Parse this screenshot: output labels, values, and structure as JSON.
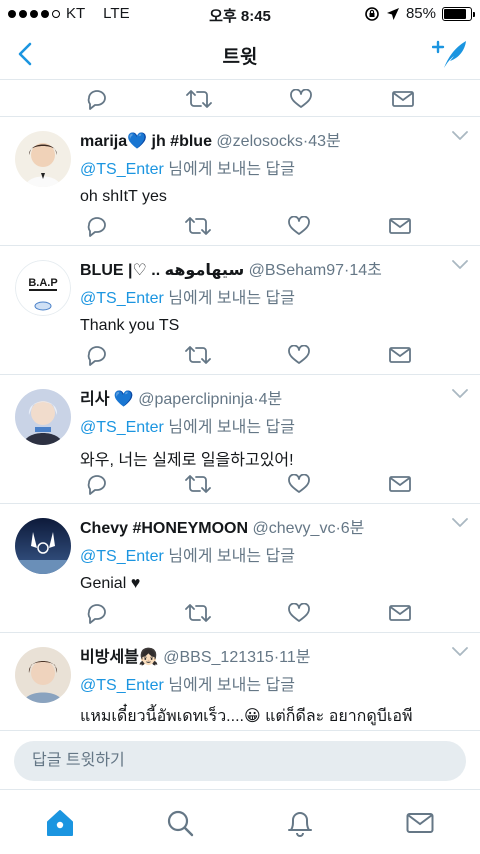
{
  "status_bar": {
    "carrier": "KT",
    "network": "LTE",
    "time": "오후 8:45",
    "battery": "85%",
    "battery_level": 0.85
  },
  "nav": {
    "title": "트윗"
  },
  "tweets": [
    {
      "name": "marija💙 jh #blue",
      "handle": "@zelosocks",
      "sep": "·",
      "time": "43분",
      "mention": "@TS_Enter",
      "reply_suffix": " 님에게 보내는 답글",
      "text": "oh shItT yes"
    },
    {
      "name": "BLUE |♡ .. سيهاموهه",
      "handle": "@BSeham97",
      "sep": "·",
      "time": "14초",
      "mention": "@TS_Enter",
      "reply_suffix": " 님에게 보내는 답글",
      "text": "Thank you TS"
    },
    {
      "name": "리사 💙",
      "handle": "@paperclipninja",
      "sep": "·",
      "time": "4분",
      "mention": "@TS_Enter",
      "reply_suffix": " 님에게 보내는 답글",
      "text": "와우, 너는 실제로 일을하고있어!"
    },
    {
      "name": "Chevy #HONEYMOON",
      "handle": "@chevy_vc",
      "sep": "·",
      "time": "6분",
      "mention": "@TS_Enter",
      "reply_suffix": " 님에게 보내는 답글",
      "text": "Genial ♥"
    },
    {
      "name": "비방세블👧🏻",
      "handle": "@BBS_121315",
      "sep": "·",
      "time": "11분",
      "mention": "@TS_Enter",
      "reply_suffix": " 님에게 보내는 답글",
      "text": "แหมเดี๋ยวนี้อัพเดทเร็ว....😀 แต่ก็ดีละ อยากดูบีเอพี"
    }
  ],
  "reply_bar": {
    "placeholder": "답글 트윗하기"
  },
  "tab_bar": {
    "items": [
      "home-icon",
      "search-icon",
      "notifications-bell-icon",
      "messages-envelope-icon"
    ]
  },
  "colors": {
    "accent": "#1b95e0",
    "secondary_text": "#657786",
    "border": "#e1e8ed",
    "icon_gray": "#657786",
    "input_bg": "#e6ecf0"
  }
}
